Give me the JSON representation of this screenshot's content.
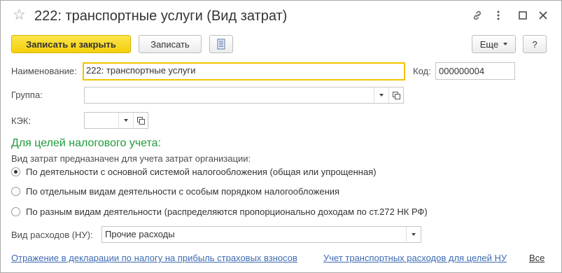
{
  "window": {
    "title": "222: транспортные услуги (Вид затрат)"
  },
  "toolbar": {
    "save_close_label": "Записать и закрыть",
    "save_label": "Записать",
    "more_label": "Еще",
    "help_label": "?"
  },
  "form": {
    "name": {
      "label": "Наименование:",
      "value": "222: транспортные услуги"
    },
    "code": {
      "label": "Код:",
      "value": "000000004"
    },
    "group": {
      "label": "Группа:",
      "value": ""
    },
    "kek": {
      "label": "КЭК:",
      "value": ""
    }
  },
  "tax": {
    "section_title": "Для целей налогового учета:",
    "purpose_text": "Вид затрат предназначен для учета затрат организации:",
    "options": [
      {
        "label": "По деятельности с основной системой налогообложения (общая или упрощенная)",
        "checked": true
      },
      {
        "label": "По отдельным видам деятельности с особым порядком налогообложения",
        "checked": false
      },
      {
        "label": "По разным видам деятельности (распределяются пропорционально доходам по ст.272 НК РФ)",
        "checked": false
      }
    ],
    "expense_type": {
      "label": "Вид расходов (НУ):",
      "value": "Прочие расходы"
    }
  },
  "links": {
    "declaration": "Отражение в декларации по налогу на прибыль страховых взносов",
    "transport": "Учет транспортных расходов для целей НУ",
    "all": "Все"
  },
  "colors": {
    "primary_button": "#f4cf0c",
    "section_title": "#1f9c3a",
    "link": "#3d6bb3",
    "focus_border": "#f2c200"
  }
}
